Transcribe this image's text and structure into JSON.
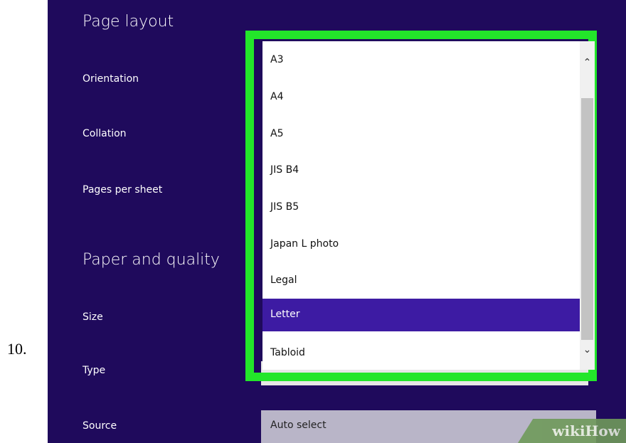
{
  "step_number": "10.",
  "sections": {
    "page_layout_heading": "Page layout",
    "paper_quality_heading": "Paper and quality"
  },
  "labels": {
    "orientation": "Orientation",
    "collation": "Collation",
    "pages_per_sheet": "Pages per sheet",
    "size": "Size",
    "type": "Type",
    "source": "Source"
  },
  "size_dropdown": {
    "options": [
      "A3",
      "A4",
      "A5",
      "JIS B4",
      "JIS B5",
      "Japan L photo",
      "Legal",
      "Letter",
      "Tabloid"
    ],
    "selected": "Letter",
    "scroll_up_icon": "chevron-up-icon",
    "scroll_down_icon": "chevron-down-icon"
  },
  "source_select": {
    "value": "Auto select",
    "icon": "chevron-down-icon"
  },
  "watermark": "wikiHow",
  "colors": {
    "panel_background": "#1f0a5c",
    "highlight_border": "#23e62a",
    "selected_option": "#3d1ba3"
  }
}
